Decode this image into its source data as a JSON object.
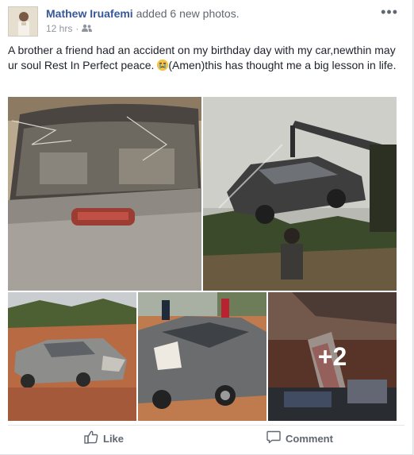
{
  "post": {
    "author": "Mathew Iruafemi",
    "action": "added 6 new photos.",
    "time": "12 hrs",
    "more_icon": "ellipsis-icon",
    "privacy_icon": "friends-icon",
    "text_before_emoji": "A brother a friend had an accident on my birthday day with my car,newthin may ur soul Rest In Perfect peace. ",
    "text_after_emoji": "(Amen)this has thought me a big lesson in life.",
    "emoji_icon": "crying-face-icon"
  },
  "photos": {
    "total": 6,
    "more_count_label": "+2"
  },
  "actions": {
    "like_label": "Like",
    "comment_label": "Comment",
    "like_icon": "thumbs-up-icon",
    "comment_icon": "speech-bubble-icon"
  }
}
